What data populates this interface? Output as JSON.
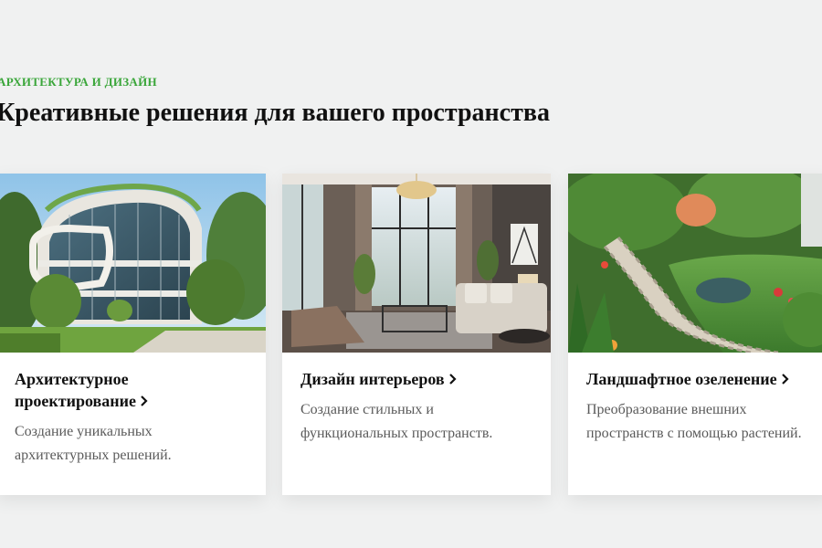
{
  "section": {
    "eyebrow": "АРХИТЕКТУРА И ДИЗАЙН",
    "heading": "Креативные решения для вашего пространства"
  },
  "colors": {
    "accent": "#3aa63a",
    "background": "#f0f1f1",
    "card": "#ffffff"
  },
  "cards": [
    {
      "title": "Архитектурное проектирование",
      "description": "Создание уникальных архитектурных решений.",
      "icon": "chevron-right-icon",
      "image": "modern-green-building-photo"
    },
    {
      "title": "Дизайн интерьеров",
      "description": "Создание стильных и функциональных пространств.",
      "icon": "chevron-right-icon",
      "image": "living-room-interior-photo"
    },
    {
      "title": "Ландшафтное озеленение",
      "description": "Преобразование внешних пространств с помощью растений.",
      "icon": "chevron-right-icon",
      "image": "garden-path-landscape-photo"
    }
  ]
}
